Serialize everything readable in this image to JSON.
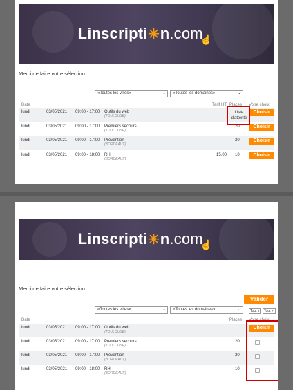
{
  "brand": {
    "name": "Linscripti",
    "name_end": "n",
    "domain": ".com",
    "accent": "#ff8a00"
  },
  "page_title": "Merci de faire votre sélection",
  "filters": {
    "cities": "«Toutes les villes»",
    "domains": "«Toutes les domaines»"
  },
  "headers": {
    "date": "Date",
    "tarif": "Tarif HT",
    "places": "Places",
    "choix": "Votre choix"
  },
  "buttons": {
    "choisir": "Choisir",
    "valider": "Valider",
    "tout_x": "Tout x",
    "tout_check": "Tout ✓"
  },
  "sessions": [
    {
      "day": "lundi",
      "date": "03/05/2021",
      "time": "09:00 - 17:00",
      "name": "Outils du web",
      "city": "(TOULOUSE)",
      "tarif": "",
      "places": "Liste d'attente"
    },
    {
      "day": "lundi",
      "date": "03/05/2021",
      "time": "09:00 - 17:00",
      "name": "Premiers secours",
      "city": "(TOULOUSE)",
      "tarif": "",
      "places": "20"
    },
    {
      "day": "lundi",
      "date": "03/05/2021",
      "time": "09:00 - 17:00",
      "name": "Prévention",
      "city": "(BORDEAUX)",
      "tarif": "",
      "places": "20"
    },
    {
      "day": "lundi",
      "date": "03/05/2021",
      "time": "09:00 - 18:00",
      "name": "RH",
      "city": "(BORDEAUX)",
      "tarif": "15,00",
      "places": "10"
    }
  ],
  "sessions2": [
    {
      "day": "lundi",
      "date": "03/05/2021",
      "time": "09:00 - 17:00",
      "name": "Outils du web",
      "city": "(TOULOUSE)",
      "places": ""
    },
    {
      "day": "lundi",
      "date": "03/05/2021",
      "time": "09:00 - 17:00",
      "name": "Premiers secours",
      "city": "(TOULOUSE)",
      "places": "20"
    },
    {
      "day": "lundi",
      "date": "03/05/2021",
      "time": "09:00 - 17:00",
      "name": "Prévention",
      "city": "(BORDEAUX)",
      "places": "20"
    },
    {
      "day": "lundi",
      "date": "03/05/2021",
      "time": "09:00 - 18:00",
      "name": "RH",
      "city": "(BORDEAUX)",
      "places": "10"
    }
  ]
}
